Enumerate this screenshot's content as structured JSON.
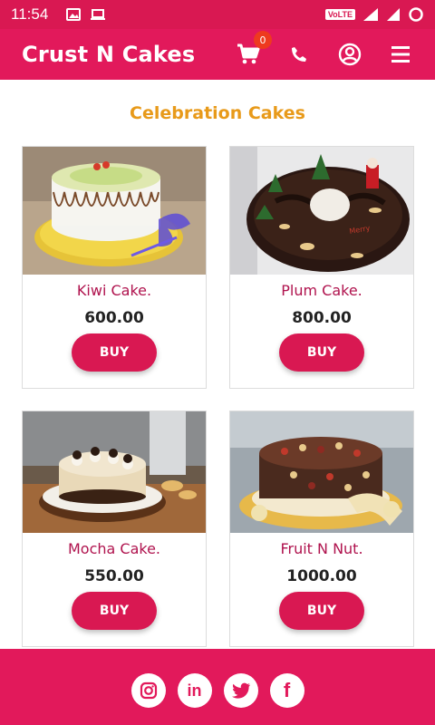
{
  "statusbar": {
    "time": "11:54",
    "volte": "VoLTE",
    "network": "4G"
  },
  "appbar": {
    "brand": "Crust N Cakes",
    "cart_count": "0"
  },
  "section_title": "Celebration Cakes",
  "products": [
    {
      "name": "Kiwi Cake.",
      "price": "600.00",
      "buy": "BUY"
    },
    {
      "name": "Plum Cake.",
      "price": "800.00",
      "buy": "BUY"
    },
    {
      "name": "Mocha Cake.",
      "price": "550.00",
      "buy": "BUY"
    },
    {
      "name": "Fruit N Nut.",
      "price": "1000.00",
      "buy": "BUY"
    }
  ],
  "footer": {
    "linkedin": "in",
    "facebook": "f"
  },
  "colors": {
    "primary": "#e2195b",
    "accent": "#e89a1a",
    "product_name": "#b0134e"
  },
  "icons": [
    "cart-icon",
    "phone-icon",
    "account-icon",
    "menu-icon",
    "instagram-icon",
    "linkedin-icon",
    "twitter-icon",
    "facebook-icon"
  ]
}
